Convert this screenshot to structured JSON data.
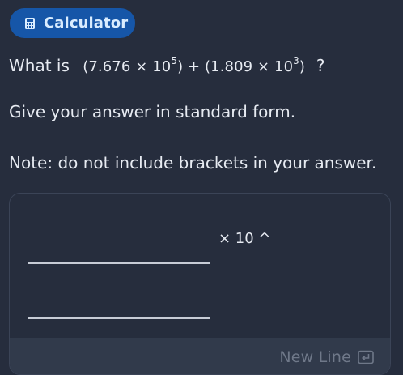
{
  "calculator_button": {
    "label": "Calculator",
    "icon": "calculator-icon"
  },
  "question": {
    "prefix": "What is",
    "expr_open_1": "(7.676 × 10",
    "exp_1": "5",
    "expr_close_1": ") + (1.809 × 10",
    "exp_2": "3",
    "expr_close_2": ")",
    "question_mark": "?"
  },
  "instruction": "Give your answer in standard form.",
  "note": "Note: do not include brackets in your answer.",
  "answer": {
    "times_ten_label": "× 10 ^",
    "new_line_label": "New Line",
    "new_line_icon": "enter-icon"
  }
}
